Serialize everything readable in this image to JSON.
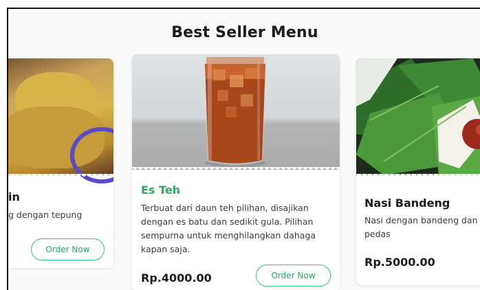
{
  "section": {
    "title": "Best Seller Menu"
  },
  "cards": [
    {
      "name": "in",
      "description": "g dengan tepung",
      "price": "",
      "button": "Order Now",
      "image": "fried-tempe-photo"
    },
    {
      "name": "Es Teh",
      "description": "Terbuat dari daun teh pilihan, disajikan dengan es batu dan sedikit gula. Pilihan sempurna untuk menghilangkan dahaga kapan saja.",
      "price": "Rp.4000.00",
      "button": "Order Now",
      "image": "iced-tea-photo"
    },
    {
      "name": "Nasi Bandeng",
      "description": "Nasi dengan bandeng dan pedas",
      "price": "Rp.5000.00",
      "button": "",
      "image": "nasi-bandeng-photo"
    }
  ],
  "colors": {
    "accent": "#2aa865",
    "title": "#1b1b1b",
    "background": "#fafafa"
  }
}
